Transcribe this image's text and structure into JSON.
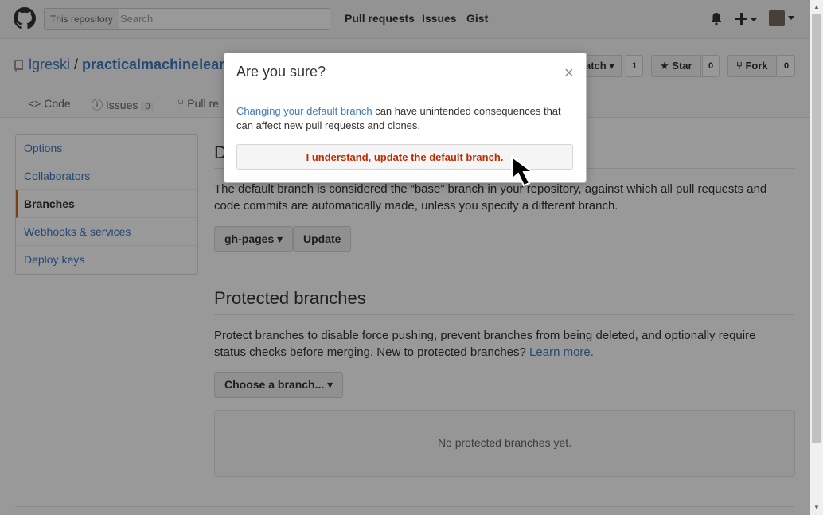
{
  "header": {
    "search_scope": "This repository",
    "search_placeholder": "Search",
    "nav": [
      "Pull requests",
      "Issues",
      "Gist"
    ]
  },
  "repo": {
    "owner": "lgreski",
    "separator": "/",
    "name": "practicalmachinelear",
    "watch_label": "atch",
    "watch_count": "1",
    "star_label": "Star",
    "star_count": "0",
    "fork_label": "Fork",
    "fork_count": "0",
    "tabs": {
      "code": "Code",
      "issues": "Issues",
      "issues_count": "0",
      "pulls": "Pull re"
    }
  },
  "settings_menu": {
    "items": [
      "Options",
      "Collaborators",
      "Branches",
      "Webhooks & services",
      "Deploy keys"
    ],
    "selected": "Branches"
  },
  "default_branch": {
    "heading_initial": "D",
    "description": "The default branch is considered the “base” branch in your repository, against which all pull requests and code commits are automatically made, unless you specify a different branch.",
    "branch_button": "gh-pages",
    "update_button": "Update"
  },
  "protected_branches": {
    "heading": "Protected branches",
    "description": "Protect branches to disable force pushing, prevent branches from being deleted, and optionally require status checks before merging. New to protected branches?",
    "learn_more": "Learn more.",
    "choose_button": "Choose a branch...",
    "empty_text": "No protected branches yet."
  },
  "dialog": {
    "title": "Are you sure?",
    "close": "×",
    "link_text": "Changing your default branch",
    "body_text": "can have unintended consequences that can affect new pull requests and clones.",
    "confirm_button": "I understand, update the default branch."
  },
  "colors": {
    "link": "#4078c0",
    "danger": "#bd2c00",
    "accent": "#d26911"
  }
}
